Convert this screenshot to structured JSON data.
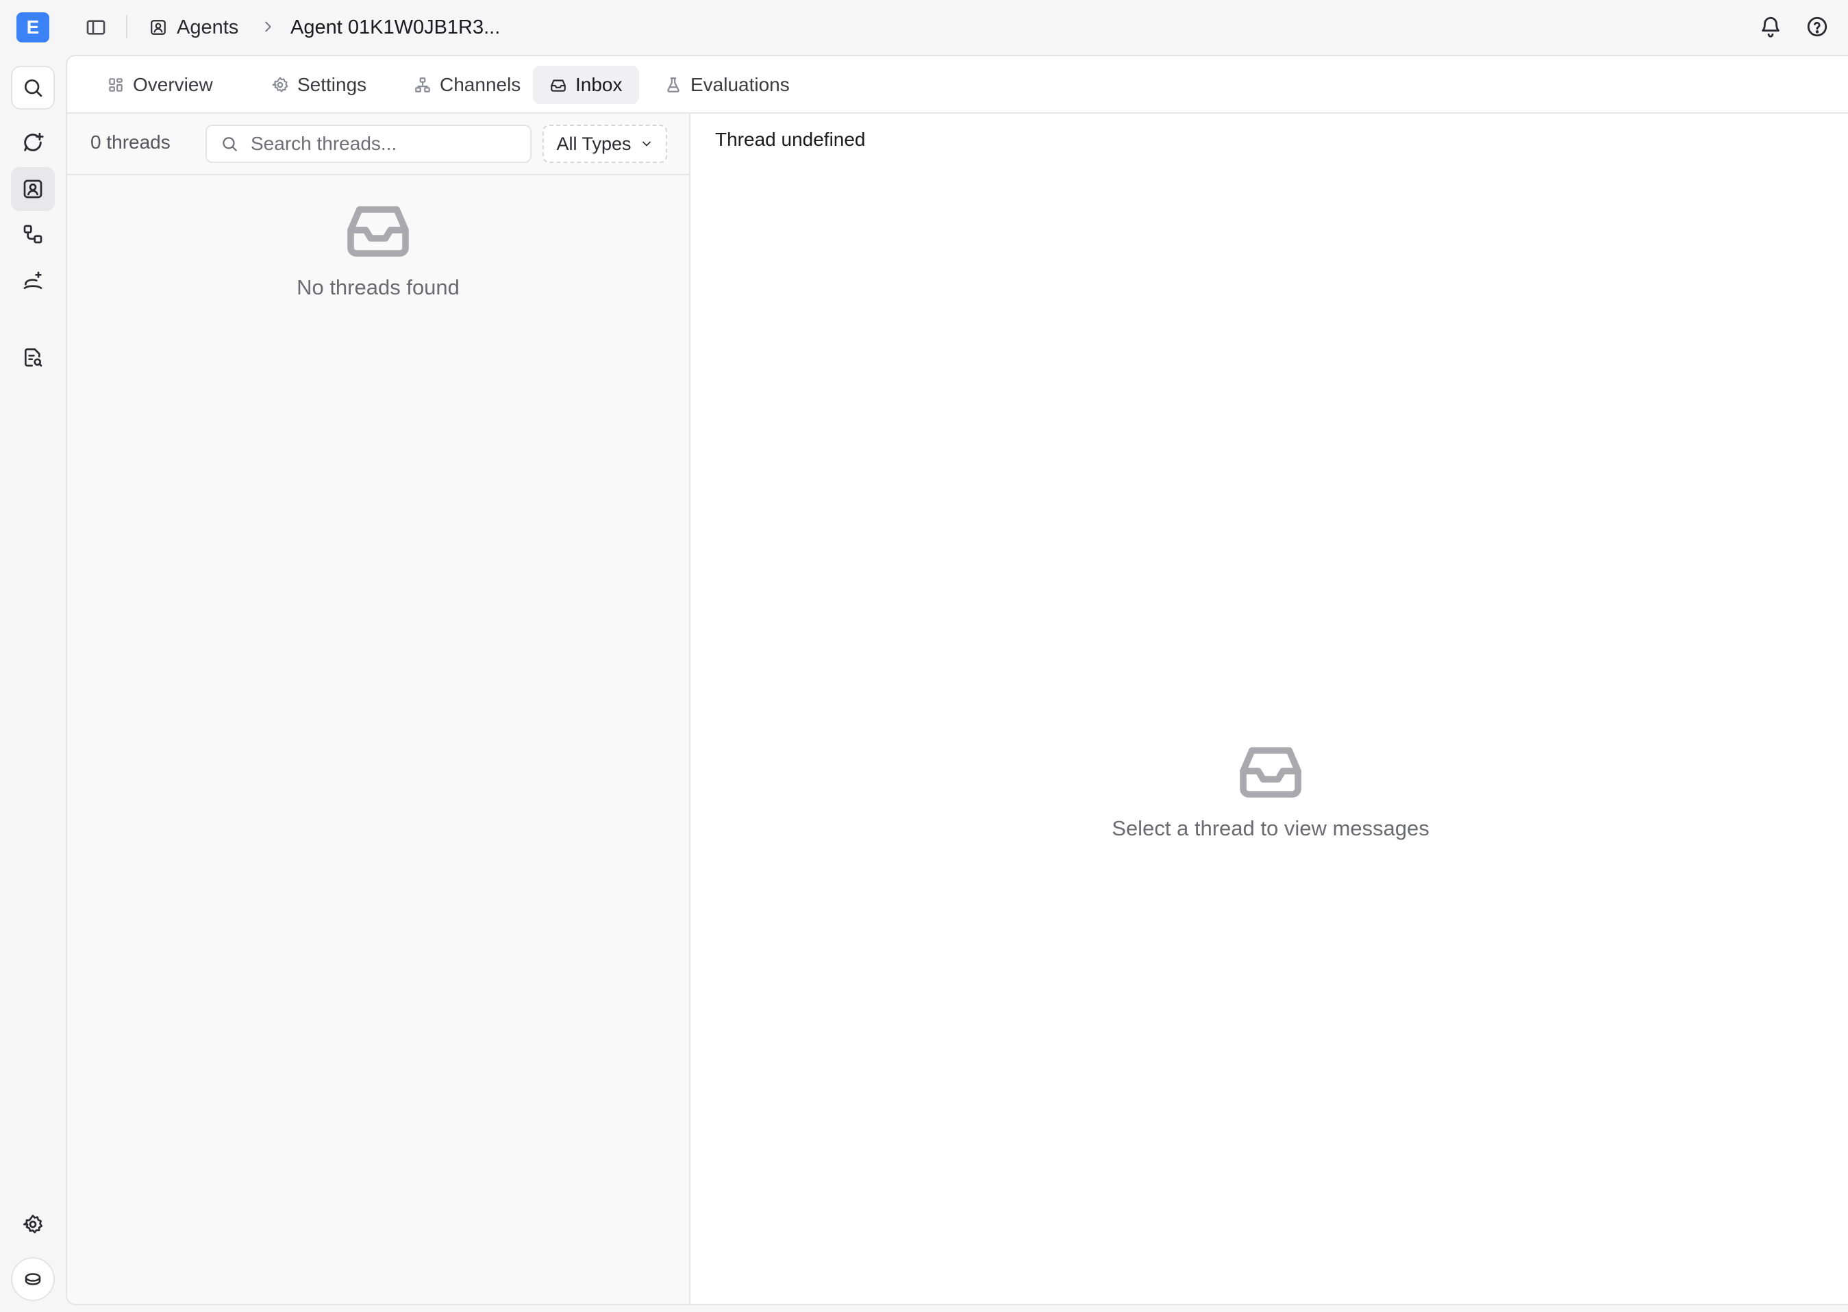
{
  "app": {
    "logo_letter": "E"
  },
  "breadcrumb": {
    "parent": "Agents",
    "current": "Agent 01K1W0JB1R3..."
  },
  "tabs": [
    {
      "label": "Overview",
      "icon": "grid-icon"
    },
    {
      "label": "Settings",
      "icon": "gear-icon"
    },
    {
      "label": "Channels",
      "icon": "network-icon"
    },
    {
      "label": "Inbox",
      "icon": "inbox-icon",
      "active": true
    },
    {
      "label": "Evaluations",
      "icon": "flask-icon"
    }
  ],
  "threads": {
    "count_label": "0 threads",
    "search_placeholder": "Search threads...",
    "type_filter": "All Types",
    "empty_text": "No threads found"
  },
  "detail": {
    "title": "Thread undefined",
    "empty_text": "Select a thread to view messages"
  },
  "colors": {
    "accent": "#3b82f6",
    "background": "#f6f6f7",
    "panel": "#ffffff",
    "border": "#e4e4e7",
    "muted_text": "#6b6b72"
  }
}
